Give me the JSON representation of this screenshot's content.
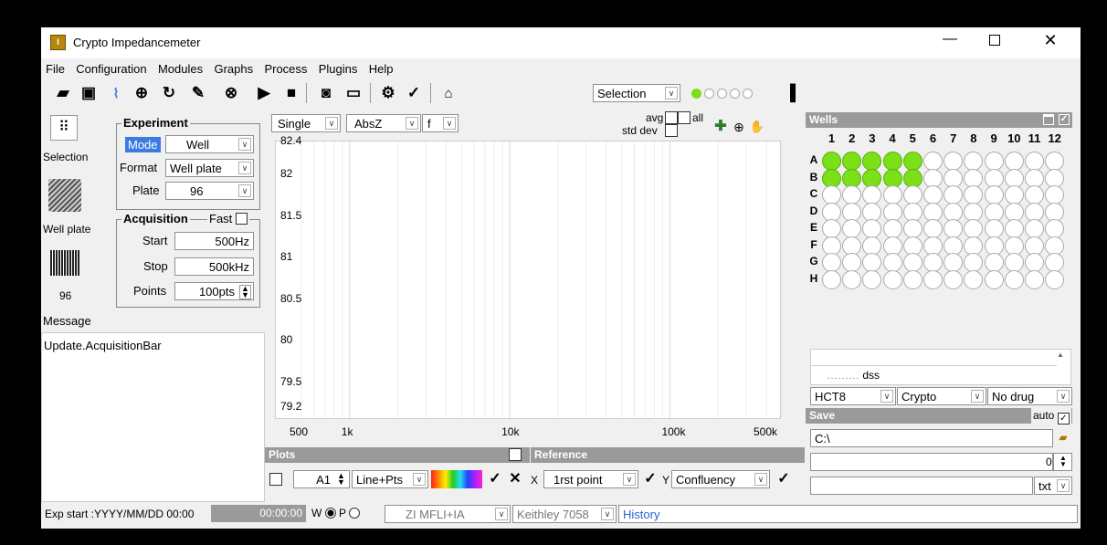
{
  "window": {
    "title": "Crypto Impedancemeter"
  },
  "menu": [
    "File",
    "Configuration",
    "Modules",
    "Graphs",
    "Process",
    "Plugins",
    "Help"
  ],
  "toolbar": {
    "mode_select": "Selection"
  },
  "left_icons": {
    "selection_label": "Selection",
    "wellplate_label": "Well plate",
    "plate96_label": "96"
  },
  "experiment": {
    "title": "Experiment",
    "mode_label": "Mode",
    "mode_value": "Well",
    "format_label": "Format",
    "format_value": "Well plate",
    "plate_label": "Plate",
    "plate_value": "96"
  },
  "acquisition": {
    "title": "Acquisition",
    "fast_label": "Fast",
    "start_label": "Start",
    "start_value": "500Hz",
    "stop_label": "Stop",
    "stop_value": "500kHz",
    "points_label": "Points",
    "points_value": "100pts"
  },
  "message": {
    "title": "Message",
    "text": "Update.AcquisitionBar"
  },
  "graph": {
    "single": "Single",
    "absz": "AbsZ",
    "f": "f",
    "avg": "avg",
    "stddev": "std dev",
    "all": "all",
    "y_ticks": [
      "82.4",
      "82",
      "81.5",
      "81",
      "80.5",
      "80",
      "79.5",
      "79.2"
    ],
    "x_ticks": [
      "500",
      "1k",
      "10k",
      "100k",
      "500k"
    ]
  },
  "chart_data": {
    "type": "line",
    "xlim": [
      500,
      500000
    ],
    "ylim": [
      79.2,
      82.4
    ],
    "x_scale": "log",
    "grid": true,
    "series": []
  },
  "plots": {
    "title": "Plots",
    "well": "A1",
    "style": "Line+Pts",
    "x_label": "X",
    "x_value": "1rst point",
    "y_label": "Y",
    "y_value": "Confluency"
  },
  "reference": {
    "title": "Reference"
  },
  "wells": {
    "title": "Wells",
    "columns": [
      "1",
      "2",
      "3",
      "4",
      "5",
      "6",
      "7",
      "8",
      "9",
      "10",
      "11",
      "12"
    ],
    "rows": [
      "A",
      "B",
      "C",
      "D",
      "E",
      "F",
      "G",
      "H"
    ],
    "active": {
      "A": 5,
      "B": 5
    }
  },
  "sample": {
    "text": "dss",
    "cell": "HCT8",
    "type": "Crypto",
    "drug": "No drug"
  },
  "save": {
    "title": "Save",
    "auto": "auto",
    "path": "C:\\",
    "counter": "0",
    "ext": "txt"
  },
  "status": {
    "exp_start": "Exp start :YYYY/MM/DD  00:00",
    "timer": "00:00:00",
    "wp": "W",
    "p": "P",
    "device1": "ZI MFLI+IA",
    "device2": "Keithley 7058",
    "history": "History"
  }
}
